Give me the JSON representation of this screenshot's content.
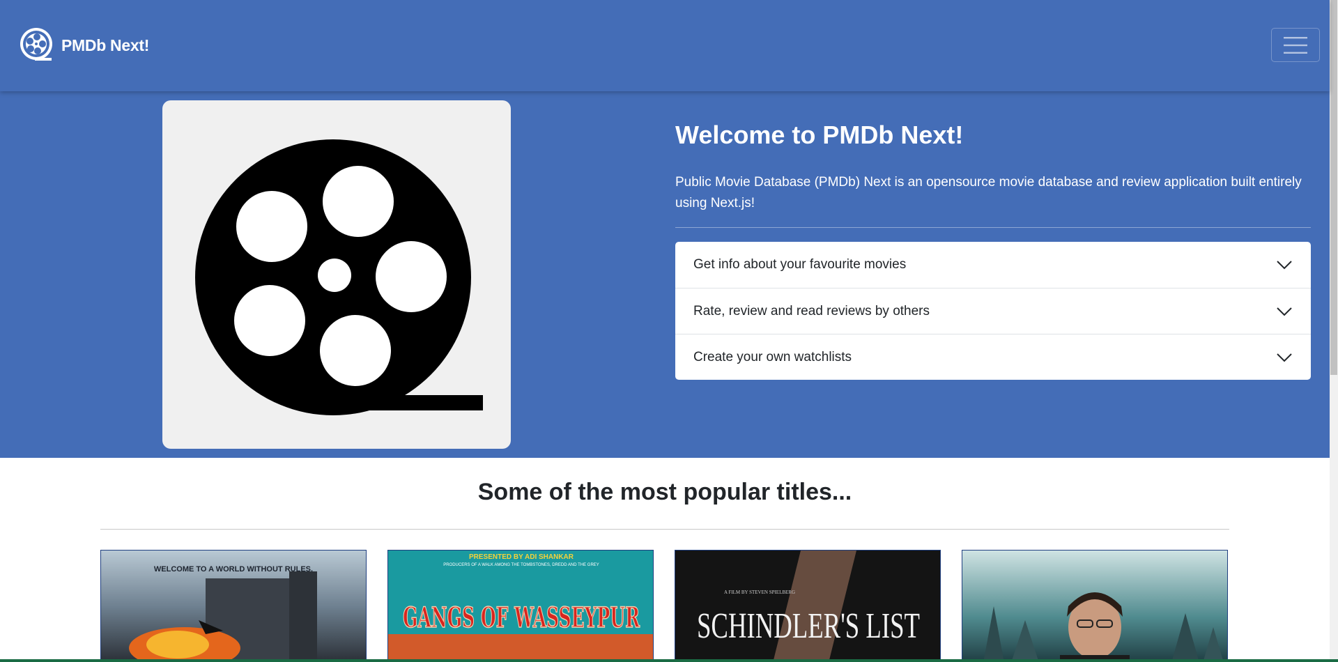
{
  "navbar": {
    "brand_name": "PMDb Next!",
    "logo_icon": "film-reel-icon",
    "toggler_icon": "hamburger-menu-icon"
  },
  "hero": {
    "image_icon": "film-reel-icon",
    "title": "Welcome to PMDb Next!",
    "description": "Public Movie Database (PMDb) Next is an opensource movie database and review application built entirely using Next.js!",
    "accordion": [
      {
        "label": "Get info about your favourite movies",
        "icon": "chevron-down-icon"
      },
      {
        "label": "Rate, review and read reviews by others",
        "icon": "chevron-down-icon"
      },
      {
        "label": "Create your own watchlists",
        "icon": "chevron-down-icon"
      }
    ]
  },
  "popular": {
    "title": "Some of the most popular titles...",
    "posters": [
      {
        "poster_text": "WELCOME TO A WORLD WITHOUT RULES."
      },
      {
        "poster_top": "PRESENTED BY ADI SHANKAR",
        "poster_sub": "PRODUCERS OF A WALK AMONG THE TOMBSTONES, DREDD AND THE GREY",
        "poster_title": "GANGS OF WASSEYPUR"
      },
      {
        "poster_top": "A FILM BY STEVEN SPIELBERG",
        "poster_title": "SCHINDLER'S LIST"
      },
      {
        "poster_text": ""
      }
    ]
  },
  "colors": {
    "brand_blue": "#446db7",
    "hero_image_bg": "#f0f0f0"
  }
}
